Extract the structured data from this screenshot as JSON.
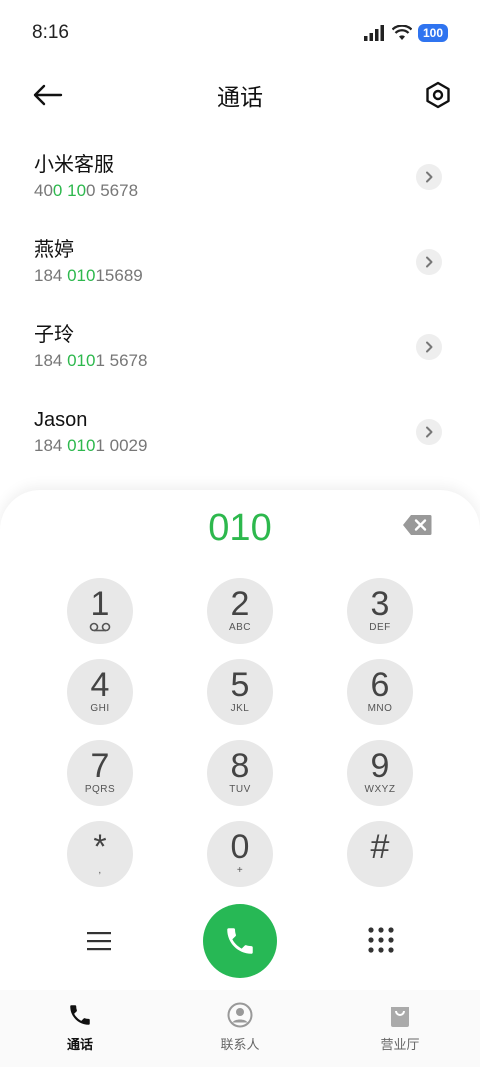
{
  "status_bar": {
    "time": "8:16",
    "battery": "100"
  },
  "header": {
    "title": "通话"
  },
  "results": [
    {
      "name": "小米客服",
      "number_parts": [
        {
          "t": "40",
          "h": false
        },
        {
          "t": "0",
          "h": true
        },
        {
          "t": " ",
          "h": false
        },
        {
          "t": "10",
          "h": true
        },
        {
          "t": "0 5678",
          "h": false
        }
      ]
    },
    {
      "name": "燕婷",
      "number_parts": [
        {
          "t": "184 ",
          "h": false
        },
        {
          "t": "010",
          "h": true
        },
        {
          "t": "15689",
          "h": false
        }
      ]
    },
    {
      "name": "子玲",
      "number_parts": [
        {
          "t": "184 ",
          "h": false
        },
        {
          "t": "010",
          "h": true
        },
        {
          "t": "1 5678",
          "h": false
        }
      ]
    },
    {
      "name": "Jason",
      "number_parts": [
        {
          "t": "184 ",
          "h": false
        },
        {
          "t": "010",
          "h": true
        },
        {
          "t": "1 0029",
          "h": false
        }
      ]
    }
  ],
  "dialer": {
    "display": "010",
    "keys": [
      {
        "digit": "1",
        "letters": ""
      },
      {
        "digit": "2",
        "letters": "ABC"
      },
      {
        "digit": "3",
        "letters": "DEF"
      },
      {
        "digit": "4",
        "letters": "GHI"
      },
      {
        "digit": "5",
        "letters": "JKL"
      },
      {
        "digit": "6",
        "letters": "MNO"
      },
      {
        "digit": "7",
        "letters": "PQRS"
      },
      {
        "digit": "8",
        "letters": "TUV"
      },
      {
        "digit": "9",
        "letters": "WXYZ"
      },
      {
        "digit": "*",
        "letters": ","
      },
      {
        "digit": "0",
        "letters": "+"
      },
      {
        "digit": "#",
        "letters": ""
      }
    ]
  },
  "bottom_nav": {
    "items": [
      {
        "label": "通话",
        "icon": "phone-icon",
        "active": true
      },
      {
        "label": "联系人",
        "icon": "person-icon",
        "active": false
      },
      {
        "label": "营业厅",
        "icon": "bag-icon",
        "active": false
      }
    ]
  },
  "colors": {
    "accent_green": "#2db84d",
    "call_green": "#27b855",
    "battery_blue": "#2f74f0"
  }
}
